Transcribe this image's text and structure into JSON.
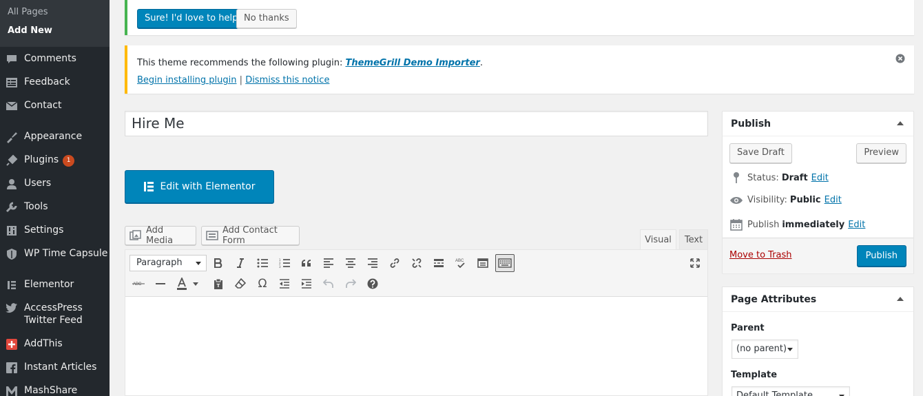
{
  "sidebar": {
    "submenu": [
      "All Pages",
      "Add New"
    ],
    "items": [
      {
        "label": "Comments",
        "icon": "comments-icon"
      },
      {
        "label": "Feedback",
        "icon": "feedback-icon"
      },
      {
        "label": "Contact",
        "icon": "mail-icon"
      },
      {
        "label": "Appearance",
        "icon": "appearance-icon"
      },
      {
        "label": "Plugins",
        "icon": "plugins-icon",
        "badge": "1"
      },
      {
        "label": "Users",
        "icon": "users-icon"
      },
      {
        "label": "Tools",
        "icon": "tools-icon"
      },
      {
        "label": "Settings",
        "icon": "settings-icon"
      },
      {
        "label": "WP Time Capsule",
        "icon": "shield-icon"
      },
      {
        "label": "Elementor",
        "icon": "elementor-icon"
      },
      {
        "label": "AccessPress Twitter Feed",
        "icon": "twitter-icon"
      },
      {
        "label": "AddThis",
        "icon": "addthis-icon"
      },
      {
        "label": "Instant Articles",
        "icon": "facebook-icon"
      },
      {
        "label": "MashShare",
        "icon": "mashshare-icon"
      }
    ]
  },
  "notice1": {
    "primary_button": "Sure! I'd love to help",
    "secondary_button": "No thanks"
  },
  "notice2": {
    "text": "This theme recommends the following plugin: ",
    "plugin_name": "ThemeGrill Demo Importer",
    "period": ".",
    "install_link": "Begin installing plugin",
    "separator": "|",
    "dismiss_link": "Dismiss this notice"
  },
  "editor": {
    "title_value": "Hire Me",
    "elementor_button": "Edit with Elementor",
    "add_media": "Add Media",
    "add_contact_form": "Add Contact Form",
    "tab_visual": "Visual",
    "tab_text": "Text",
    "format_select": "Paragraph"
  },
  "publish": {
    "title": "Publish",
    "save_draft": "Save Draft",
    "preview": "Preview",
    "status_label": "Status:",
    "status_value": "Draft",
    "visibility_label": "Visibility:",
    "visibility_value": "Public",
    "publish_label": "Publish",
    "publish_value": "immediately",
    "edit": "Edit",
    "move_to_trash": "Move to Trash",
    "publish_button": "Publish"
  },
  "page_attributes": {
    "title": "Page Attributes",
    "parent_label": "Parent",
    "parent_value": "(no parent)",
    "template_label": "Template",
    "template_value": "Default Template"
  },
  "colors": {
    "accent": "#0085ba",
    "sidebar": "#23282d",
    "success": "#46b450",
    "warning": "#ffb900",
    "trash": "#a00"
  }
}
